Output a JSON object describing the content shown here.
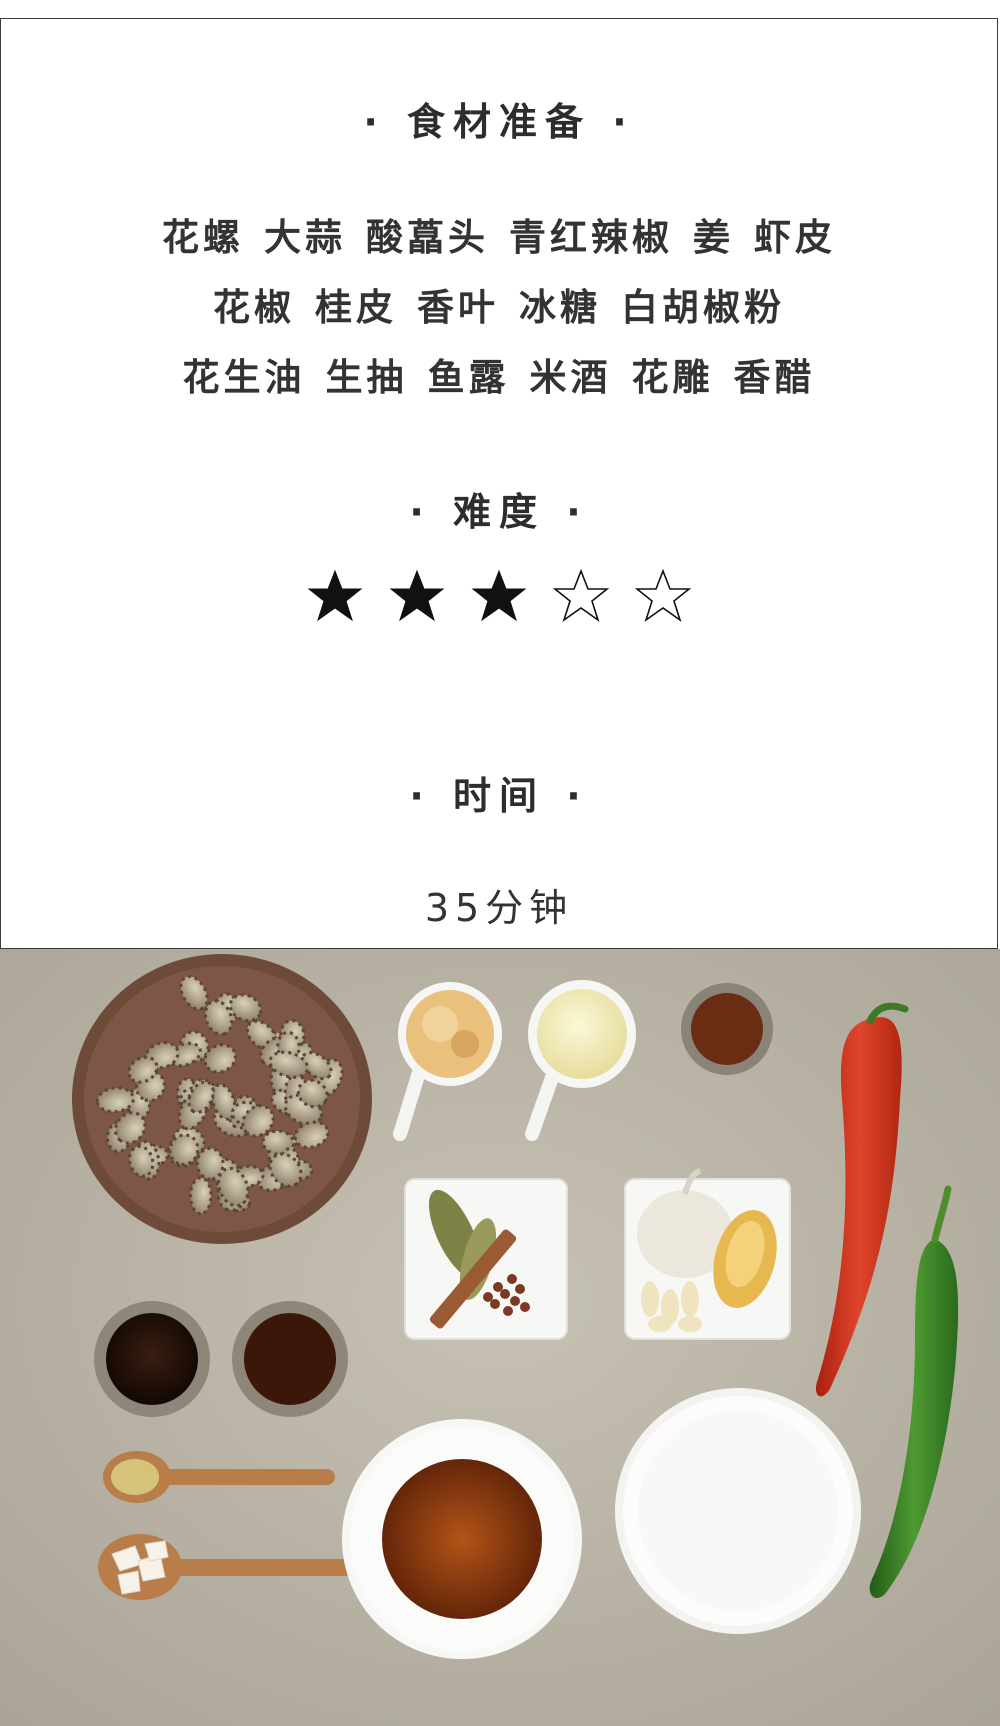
{
  "ingredients_section": {
    "title": "· 食材准备 ·",
    "lines": [
      [
        "花螺",
        "大蒜",
        "酸藠头",
        "青红辣椒",
        "姜",
        "虾皮"
      ],
      [
        "花椒",
        "桂皮",
        "香叶",
        "冰糖",
        "白胡椒粉"
      ],
      [
        "花生油",
        "生抽",
        "鱼露",
        "米酒",
        "花雕",
        "香醋"
      ]
    ]
  },
  "difficulty_section": {
    "title": "· 难度 ·",
    "rating": 3,
    "max_rating": 5,
    "star_color": "#111111"
  },
  "time_section": {
    "title": "· 时间 ·",
    "value": "35分钟"
  },
  "photo": {
    "background_color": "#b9b4a6",
    "chili_red": "#d63a23",
    "chili_green": "#3d8a2a"
  }
}
